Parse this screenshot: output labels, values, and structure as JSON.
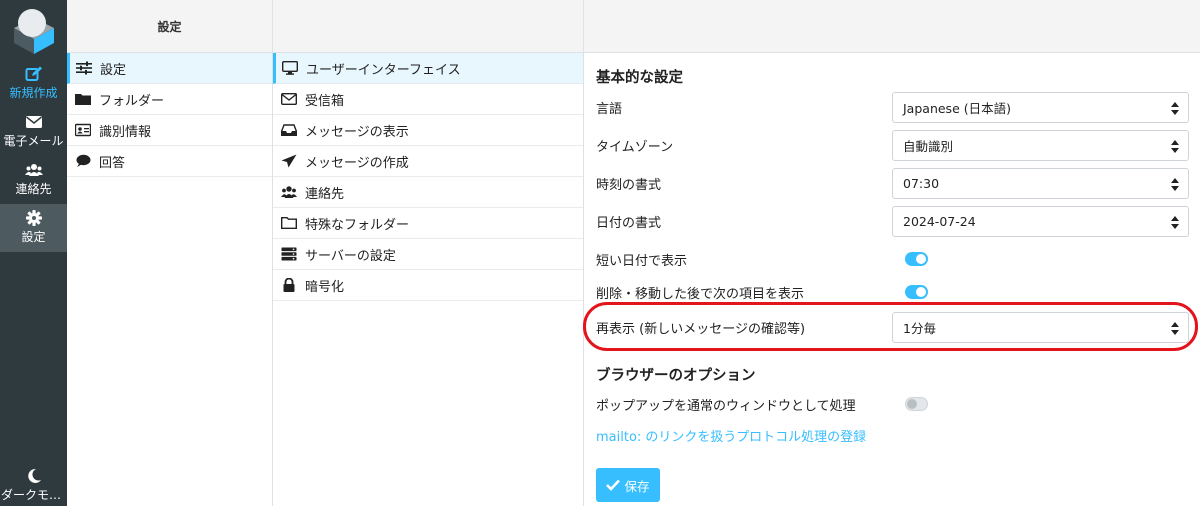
{
  "nav": {
    "compose": "新規作成",
    "mail": "電子メール",
    "contacts": "連絡先",
    "settings": "設定",
    "dark_mode": "ダークモー..."
  },
  "col1": {
    "header": "設定",
    "items": [
      {
        "label": "設定",
        "icon": "sliders-icon"
      },
      {
        "label": "フォルダー",
        "icon": "folder-icon"
      },
      {
        "label": "識別情報",
        "icon": "id-card-icon"
      },
      {
        "label": "回答",
        "icon": "comment-icon"
      }
    ]
  },
  "col2": {
    "items": [
      {
        "label": "ユーザーインターフェイス",
        "icon": "monitor-icon"
      },
      {
        "label": "受信箱",
        "icon": "envelope-icon"
      },
      {
        "label": "メッセージの表示",
        "icon": "inbox-icon"
      },
      {
        "label": "メッセージの作成",
        "icon": "paper-plane-icon"
      },
      {
        "label": "連絡先",
        "icon": "users-icon"
      },
      {
        "label": "特殊なフォルダー",
        "icon": "folder-outline-icon"
      },
      {
        "label": "サーバーの設定",
        "icon": "server-icon"
      },
      {
        "label": "暗号化",
        "icon": "lock-icon"
      }
    ]
  },
  "main": {
    "basic_title": "基本的な設定",
    "language_label": "言語",
    "language_value": "Japanese (日本語)",
    "timezone_label": "タイムゾーン",
    "timezone_value": "自動識別",
    "time_format_label": "時刻の書式",
    "time_format_value": "07:30",
    "date_format_label": "日付の書式",
    "date_format_value": "2024-07-24",
    "short_date_label": "短い日付で表示",
    "short_date_on": true,
    "next_item_label": "削除・移動した後で次の項目を表示",
    "next_item_on": true,
    "refresh_label": "再表示 (新しいメッセージの確認等)",
    "refresh_value": "1分毎",
    "browser_title": "ブラウザーのオプション",
    "popup_label": "ポップアップを通常のウィンドウとして処理",
    "popup_on": false,
    "mailto_link": "mailto: のリンクを扱うプロトコル処理の登録",
    "save_label": "保存"
  },
  "colors": {
    "accent": "#37beff",
    "nav_bg": "#2f3a3f",
    "highlight": "#e3141c"
  }
}
